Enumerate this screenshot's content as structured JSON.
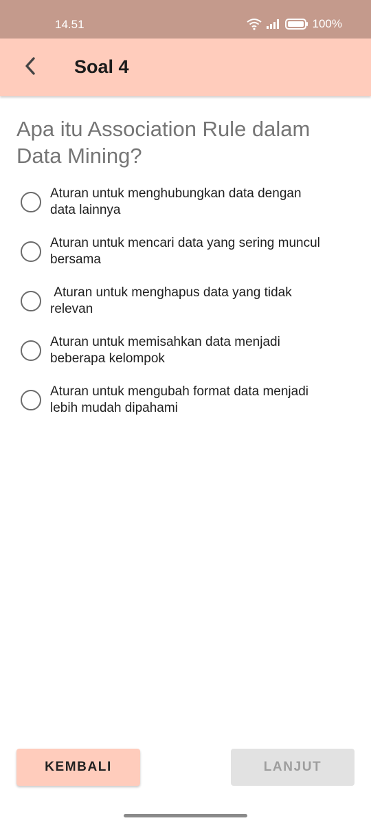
{
  "status_bar": {
    "time": "14.51",
    "battery": "100%",
    "icons": [
      "wifi-icon",
      "signal-icon",
      "battery-icon"
    ]
  },
  "app_bar": {
    "title": "Soal 4",
    "back_icon": "chevron-left-icon",
    "color": "#ffccbc"
  },
  "question": {
    "text": "Apa itu Association Rule dalam Data Mining?",
    "options": [
      "Aturan untuk menghubungkan data dengan\ndata lainnya",
      "Aturan untuk mencari data yang sering muncul\nbersama",
      " Aturan untuk menghapus data yang tidak\nrelevan",
      "Aturan untuk memisahkan data menjadi\nbeberapa kelompok",
      "Aturan untuk mengubah format data menjadi\nlebih mudah dipahami"
    ]
  },
  "buttons": {
    "back_label": "KEMBALI",
    "next_label": "LANJUT",
    "next_enabled": false
  }
}
